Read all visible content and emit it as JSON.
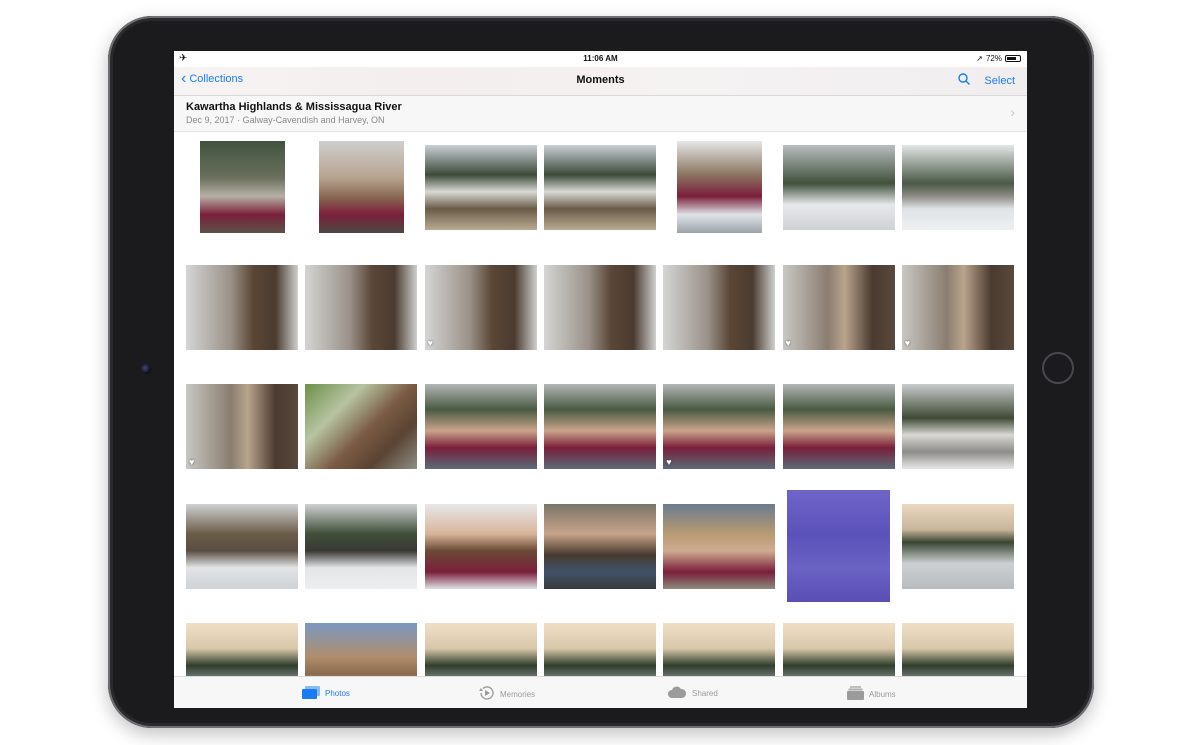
{
  "status_bar": {
    "time": "11:06 AM",
    "battery_text": "72%",
    "battery_level": 0.72
  },
  "nav": {
    "back_label": "Collections",
    "title": "Moments",
    "select_label": "Select"
  },
  "moment": {
    "location": "Kawartha Highlands & Mississagua River",
    "date": "Dec 9, 2017",
    "place": "Galway-Cavendish and Harvey, ON"
  },
  "photos": [
    {
      "type": "portrait-girl",
      "orient": "portrait"
    },
    {
      "type": "portrait-girl-side",
      "orient": "portrait"
    },
    {
      "type": "creek",
      "orient": "landscape"
    },
    {
      "type": "creek",
      "orient": "landscape"
    },
    {
      "type": "girl-snow",
      "orient": "portrait"
    },
    {
      "type": "snow-trees",
      "orient": "landscape"
    },
    {
      "type": "snow-field",
      "orient": "landscape"
    },
    {
      "type": "squirrel-tree",
      "orient": "landscape"
    },
    {
      "type": "squirrel-tree",
      "orient": "landscape"
    },
    {
      "type": "squirrel-tree",
      "orient": "landscape",
      "favorite": true
    },
    {
      "type": "squirrel-tree",
      "orient": "landscape"
    },
    {
      "type": "squirrel-tree",
      "orient": "landscape"
    },
    {
      "type": "squirrel-branch",
      "orient": "landscape",
      "favorite": true
    },
    {
      "type": "squirrel-branch",
      "orient": "landscape",
      "favorite": true
    },
    {
      "type": "squirrel-branch",
      "orient": "landscape",
      "favorite": true
    },
    {
      "type": "squirrel-pine",
      "orient": "landscape"
    },
    {
      "type": "couple-selfie",
      "orient": "landscape"
    },
    {
      "type": "couple-selfie",
      "orient": "landscape"
    },
    {
      "type": "couple-selfie",
      "orient": "landscape",
      "favorite": true
    },
    {
      "type": "couple-selfie",
      "orient": "landscape"
    },
    {
      "type": "boardwalk",
      "orient": "landscape"
    },
    {
      "type": "group-cabin",
      "orient": "landscape"
    },
    {
      "type": "group-snow",
      "orient": "landscape"
    },
    {
      "type": "girl-closeup",
      "orient": "landscape"
    },
    {
      "type": "couple-street",
      "orient": "landscape"
    },
    {
      "type": "girl-leaves",
      "orient": "landscape"
    },
    {
      "type": "purple-door",
      "orient": "portrait"
    },
    {
      "type": "lake-sunset",
      "orient": "landscape"
    },
    {
      "type": "lake-trees",
      "orient": "landscape"
    },
    {
      "type": "house",
      "orient": "landscape"
    },
    {
      "type": "lake-trees",
      "orient": "landscape"
    },
    {
      "type": "lake-trees",
      "orient": "landscape"
    },
    {
      "type": "lake-trees",
      "orient": "landscape"
    },
    {
      "type": "lake-trees",
      "orient": "landscape"
    },
    {
      "type": "lake-trees",
      "orient": "landscape"
    }
  ],
  "tabs": [
    {
      "label": "Photos",
      "icon": "photos-icon",
      "active": true
    },
    {
      "label": "Memories",
      "icon": "memories-icon",
      "active": false
    },
    {
      "label": "Shared",
      "icon": "cloud-icon",
      "active": false
    },
    {
      "label": "Albums",
      "icon": "albums-icon",
      "active": false
    }
  ],
  "colors": {
    "accent": "#1a7cf2",
    "inactive_tab": "#9b9b9b",
    "device_frame": "#1b1b1d"
  }
}
